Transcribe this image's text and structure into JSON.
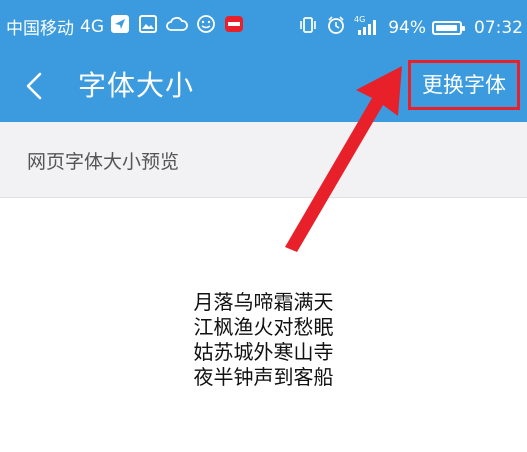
{
  "status_bar": {
    "carrier": "中国移动",
    "network": "4G",
    "battery_percent": "94%",
    "battery_level": 0.94,
    "time": "07:32",
    "icons_left": [
      "navigation-app-icon",
      "gallery-icon",
      "weather-icon",
      "face-icon",
      "app-badge-icon"
    ],
    "icons_right": [
      "vibrate-icon",
      "alarm-icon",
      "signal-4g-icon",
      "battery-icon"
    ]
  },
  "app_bar": {
    "title": "字体大小",
    "action_label": "更换字体",
    "back_icon": "chevron-left-icon"
  },
  "section": {
    "label": "网页字体大小预览"
  },
  "preview": {
    "lines": [
      "月落乌啼霜满天",
      "江枫渔火对愁眠",
      "姑苏城外寒山寺",
      "夜半钟声到客船"
    ]
  },
  "colors": {
    "header_blue": "#3b9bde",
    "annotation_red": "#e8202a",
    "section_bg": "#f2f2f4"
  }
}
